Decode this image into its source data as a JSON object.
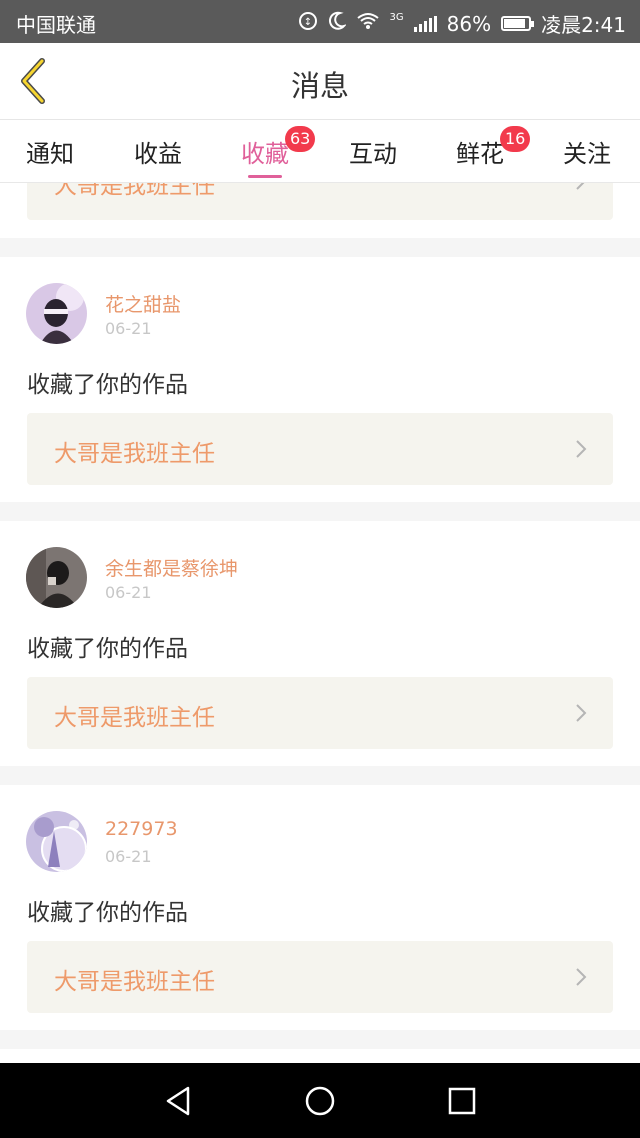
{
  "status_bar": {
    "carrier": "中国联通",
    "battery": "86%",
    "time": "凌晨2:41",
    "network": "3G",
    "battery_level": 0.86
  },
  "header": {
    "title": "消息"
  },
  "tabs": [
    {
      "label": "通知"
    },
    {
      "label": "收益"
    },
    {
      "label": "收藏",
      "badge": "63",
      "active": true
    },
    {
      "label": "互动"
    },
    {
      "label": "鲜花",
      "badge": "16"
    },
    {
      "label": "关注"
    }
  ],
  "feed": {
    "partial_item": {
      "work_title": "大哥是我班主任"
    },
    "items": [
      {
        "user": "花之甜盐",
        "date": "06-21",
        "action": "收藏了你的作品",
        "work_title": "大哥是我班主任"
      },
      {
        "user": "余生都是蔡徐坤",
        "date": "06-21",
        "action": "收藏了你的作品",
        "work_title": "大哥是我班主任"
      },
      {
        "user": "227973",
        "date": "06-21",
        "action": "收藏了你的作品",
        "work_title": "大哥是我班主任"
      }
    ]
  },
  "colors": {
    "accent": "#e0609a",
    "badge": "#f23a4c",
    "username": "#e8976c",
    "work_title": "#ee9a6a",
    "work_bg": "#f5f4ee"
  }
}
